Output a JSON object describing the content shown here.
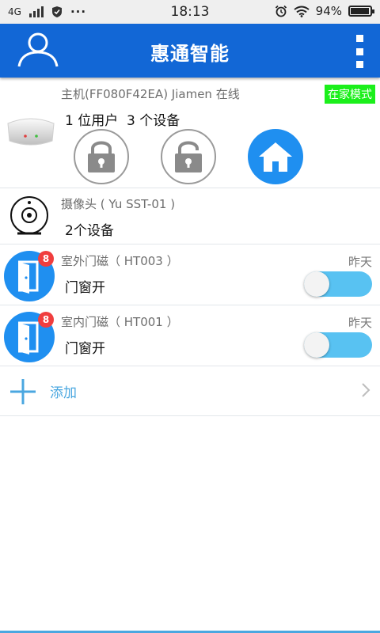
{
  "status_bar": {
    "network": "4G",
    "time": "18:13",
    "battery": "94%",
    "icons": [
      "signal-icon",
      "shield-icon",
      "more-dots-icon",
      "alarm-icon",
      "wifi-icon",
      "battery-icon"
    ]
  },
  "app_bar": {
    "title": "惠通智能",
    "left_icon": "user-icon",
    "right_icon": "more-vert-icon"
  },
  "hub": {
    "info": "主机(FF080F42EA) Jiamen 在线",
    "mode_badge": "在家模式",
    "summary": "1 位用户  3 个设备",
    "buttons": [
      {
        "name": "arm-lock",
        "icon": "lock-closed-icon",
        "active": false
      },
      {
        "name": "disarm-lock",
        "icon": "lock-open-icon",
        "active": false
      },
      {
        "name": "home-mode",
        "icon": "home-icon",
        "active": true
      }
    ]
  },
  "camera": {
    "info": "摄像头 ( Yu SST-01 )",
    "summary": "2个设备"
  },
  "devices": [
    {
      "title": "室外门磁（ HT003 ）",
      "status": "门窗开",
      "time": "昨天",
      "badge": "8",
      "toggle_on": false
    },
    {
      "title": "室内门磁（ HT001 ）",
      "status": "门窗开",
      "time": "昨天",
      "badge": "8",
      "toggle_on": false
    }
  ],
  "add": {
    "label": "添加"
  },
  "colors": {
    "primary": "#1267d6",
    "accent": "#1f8ff0",
    "mode_badge": "#1bef1b",
    "toggle": "#58c2f2",
    "badge": "#f03e3e"
  }
}
